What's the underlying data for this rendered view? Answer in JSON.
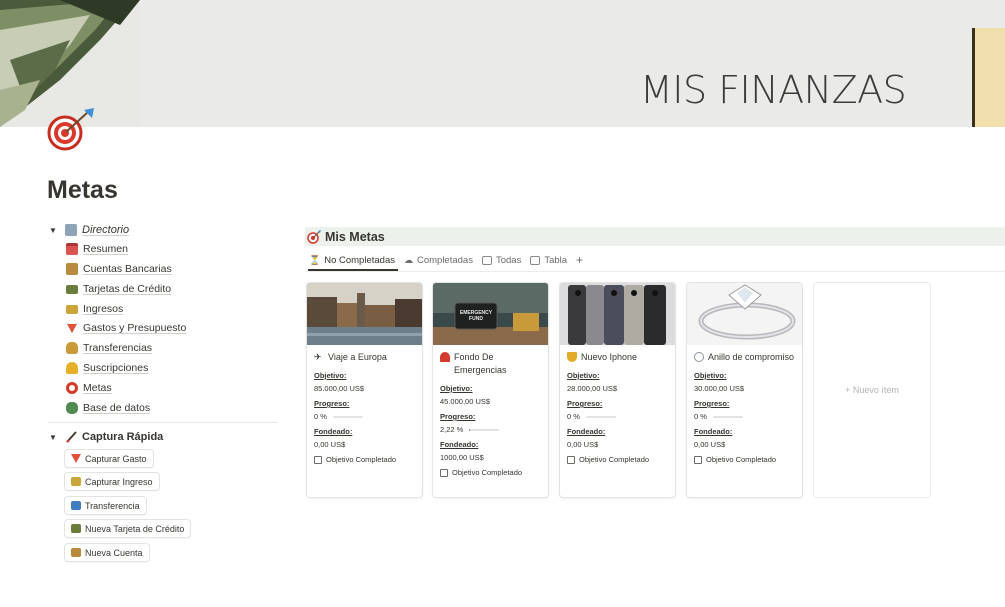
{
  "cover": {
    "title": "MIS FINANZAS"
  },
  "page": {
    "title": "Metas",
    "icon": "target-dart-icon"
  },
  "directory": {
    "label": "Directorio",
    "icon": "folder-icon",
    "items": [
      {
        "label": "Resumen",
        "icon": "calendar-icon",
        "color": "#d9534f"
      },
      {
        "label": "Cuentas Bancarias",
        "icon": "bank-icon",
        "color": "#b88a3b"
      },
      {
        "label": "Tarjetas de Crédito",
        "icon": "credit-card-icon",
        "color": "#6a7d3a"
      },
      {
        "label": "Ingresos",
        "icon": "money-icon",
        "color": "#c9a53a"
      },
      {
        "label": "Gastos y Presupuesto",
        "icon": "down-triangle-icon",
        "color": "#e0503a"
      },
      {
        "label": "Transferencias",
        "icon": "money-bag-icon",
        "color": "#c99a3a"
      },
      {
        "label": "Suscripciones",
        "icon": "bell-icon",
        "color": "#e5b12b"
      },
      {
        "label": "Metas",
        "icon": "target-icon",
        "color": "#d33a2c"
      },
      {
        "label": "Base de datos",
        "icon": "database-icon",
        "color": "#4f8a52"
      }
    ]
  },
  "quick_capture": {
    "label": "Captura Rápida",
    "icon": "pen-icon",
    "buttons": [
      {
        "label": "Capturar Gasto",
        "icon": "down-triangle-icon",
        "color": "#e0503a"
      },
      {
        "label": "Capturar Ingreso",
        "icon": "money-icon",
        "color": "#c9a53a"
      },
      {
        "label": "Transferencia",
        "icon": "arrow-right-icon",
        "color": "#3f7fbf"
      },
      {
        "label": "Nueva Tarjeta de Crédito",
        "icon": "credit-card-icon",
        "color": "#6a7d3a"
      },
      {
        "label": "Nueva Cuenta",
        "icon": "bank-icon",
        "color": "#b88a3b"
      }
    ]
  },
  "database": {
    "title": "Mis Metas",
    "tabs": [
      {
        "label": "No Completadas",
        "icon": "hourglass-icon"
      },
      {
        "label": "Completadas",
        "icon": "cloud-check-icon"
      },
      {
        "label": "Todas",
        "icon": "gallery-icon"
      },
      {
        "label": "Tabla",
        "icon": "table-icon"
      }
    ],
    "add_view": "+",
    "labels": {
      "objetivo": "Objetivo:",
      "progreso": "Progreso:",
      "fondeado": "Fondeado:",
      "completado": "Objetivo Completado"
    },
    "cards": [
      {
        "title": "Viaje a Europa",
        "icon": "airplane-icon",
        "objetivo": "85.000,00 US$",
        "progreso": "0 %",
        "progress_value": 0,
        "fondeado": "0,00 US$"
      },
      {
        "title": "Fondo De Emergencias",
        "icon": "siren-icon",
        "objetivo": "45.000,00 US$",
        "progreso": "2,22 %",
        "progress_value": 0.0222,
        "fondeado": "1000,00 US$",
        "image_text": "EMERGENCY FUND"
      },
      {
        "title": "Nuevo Iphone",
        "icon": "trophy-icon",
        "objetivo": "28.000,00 US$",
        "progreso": "0 %",
        "progress_value": 0,
        "fondeado": "0,00 US$"
      },
      {
        "title": "Anillo de compromiso",
        "icon": "ring-icon",
        "objetivo": "30.000,00 US$",
        "progreso": "0 %",
        "progress_value": 0,
        "fondeado": "0,00 US$"
      }
    ],
    "new_item": "+ Nuevo ítem"
  }
}
